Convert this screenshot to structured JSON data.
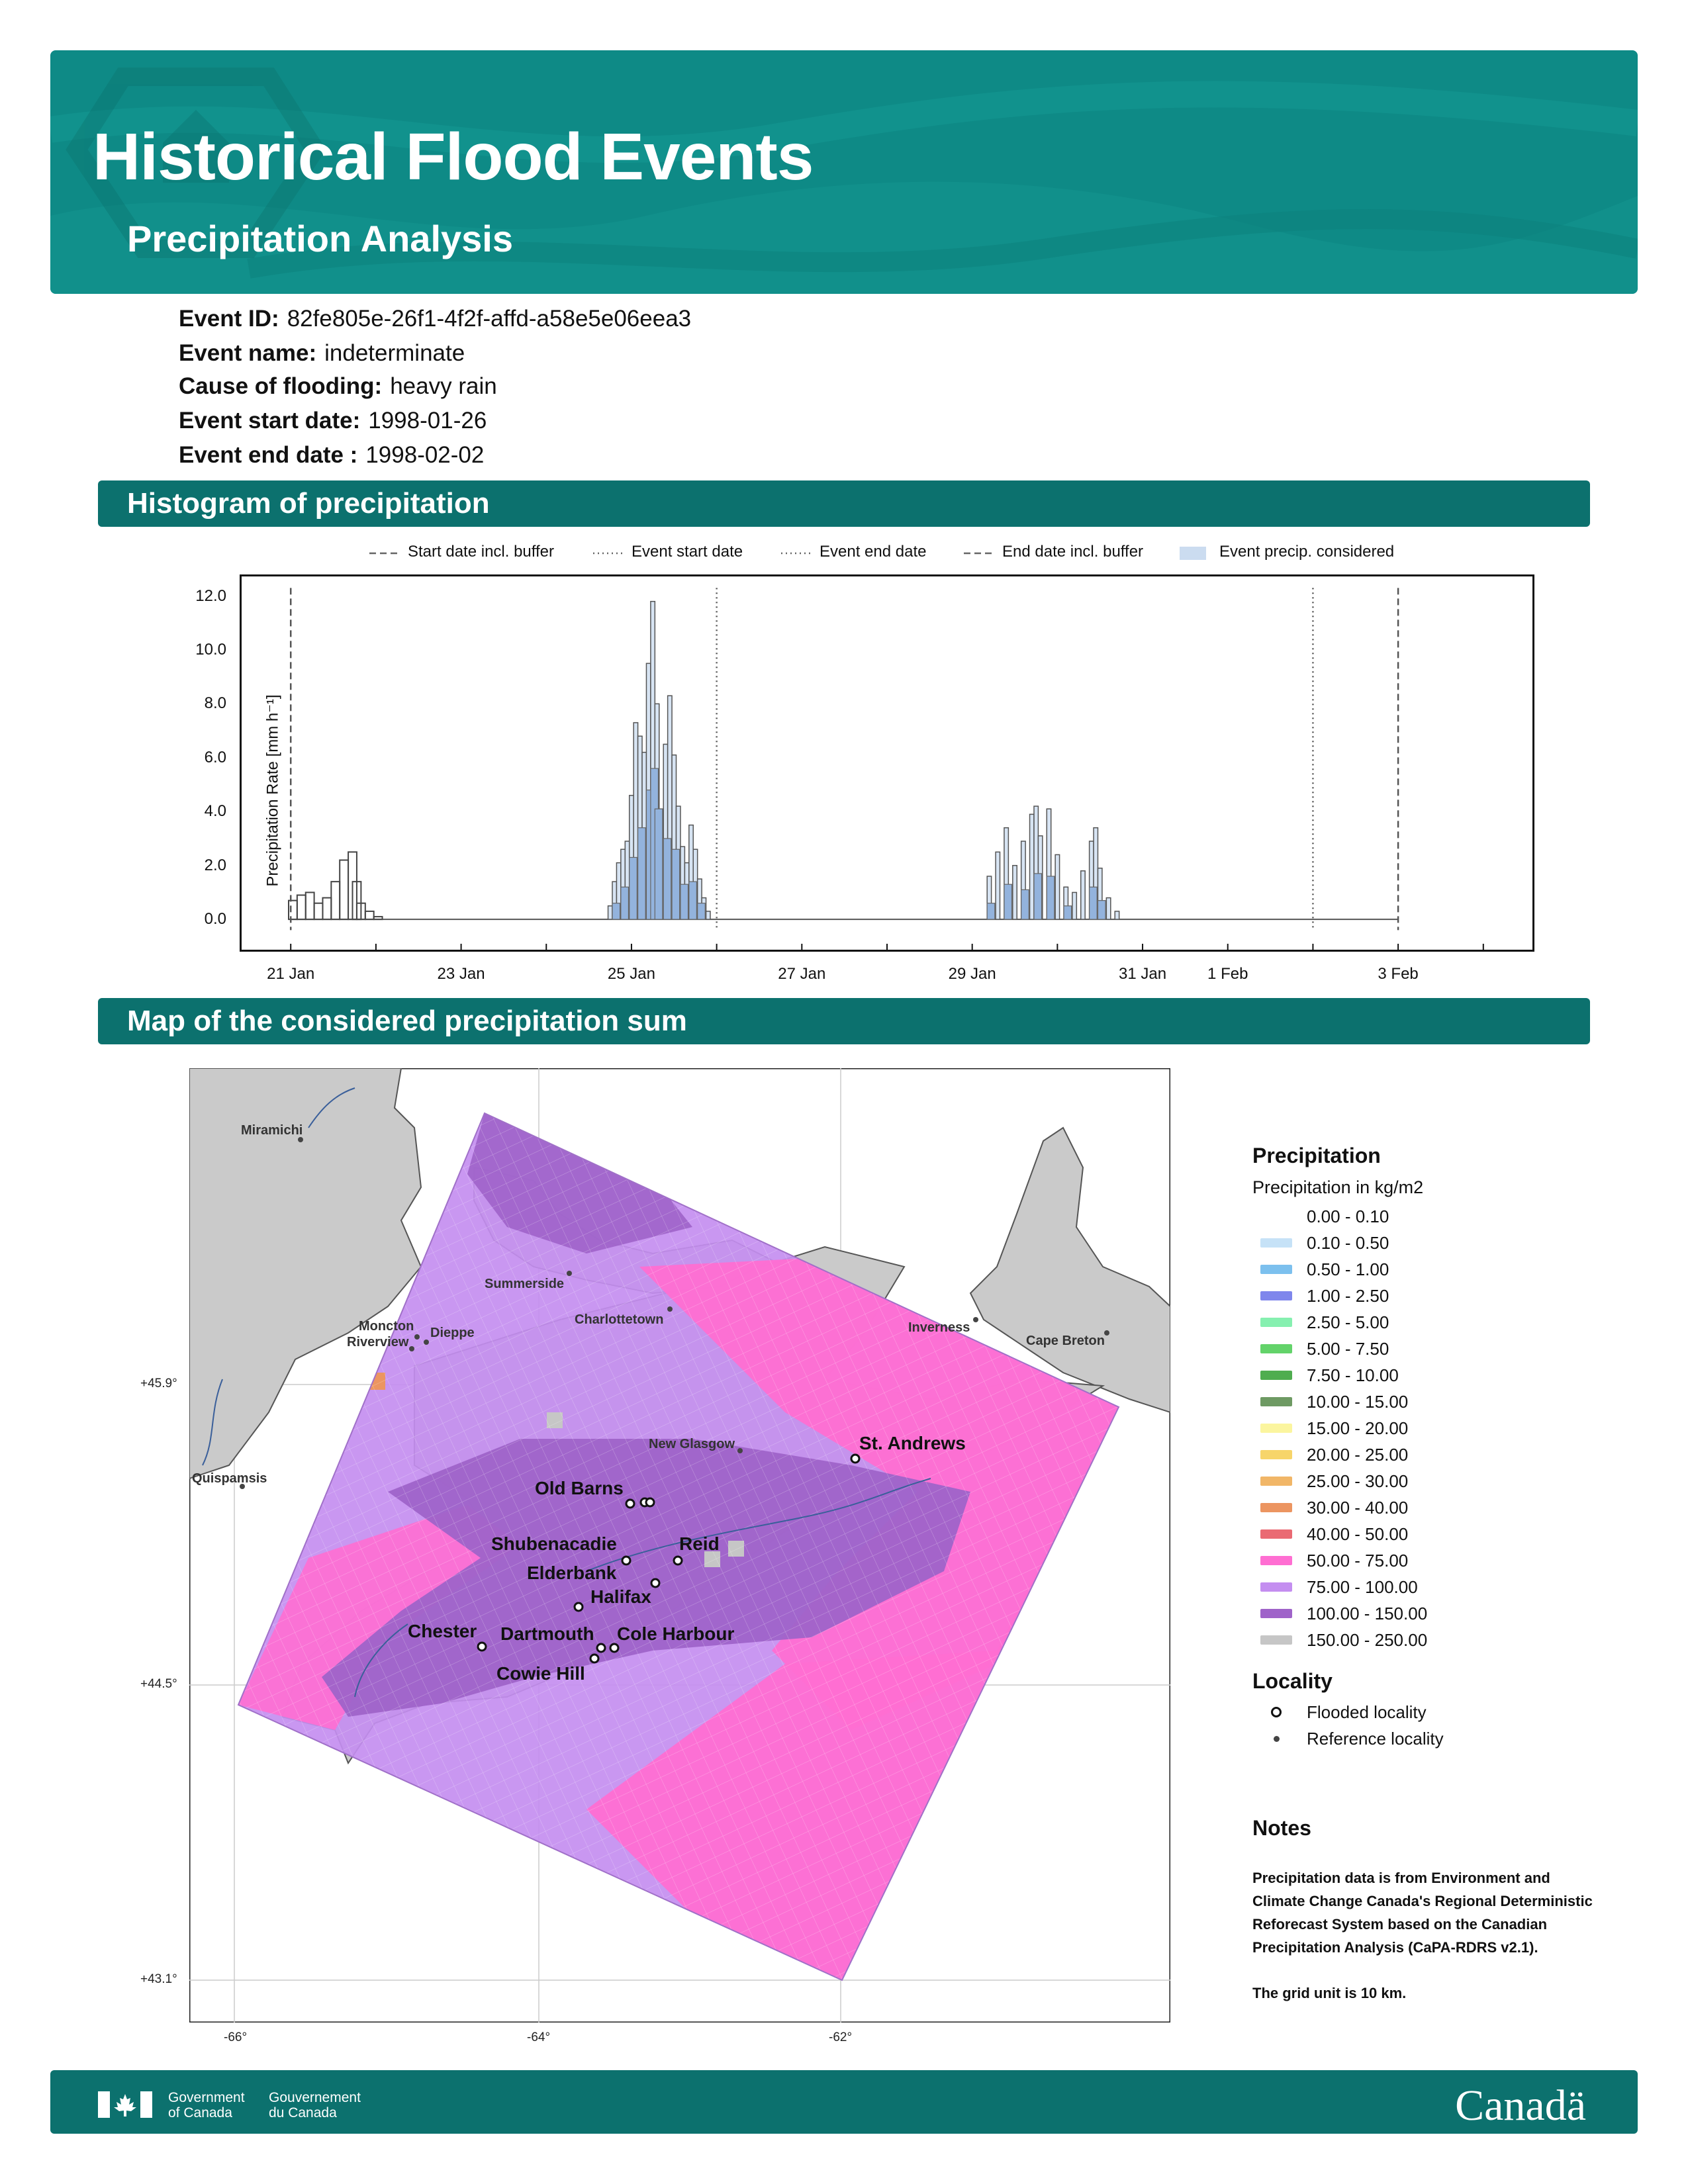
{
  "header": {
    "title": "Historical Flood Events",
    "subtitle": "Precipitation Analysis",
    "brand_color": "#0e8a86",
    "icon": "house-flood-logo"
  },
  "event": {
    "id_label": "Event ID:",
    "id_value": "82fe805e-26f1-4f2f-affd-a58e5e06eea3",
    "name_label": "Event name:",
    "name_value": "indeterminate",
    "cause_label": "Cause of flooding:",
    "cause_value": "heavy rain",
    "start_label": "Event start date:",
    "start_value": "1998-01-26",
    "end_label": "Event end date :",
    "end_value": "1998-02-02"
  },
  "sections": {
    "histogram_title": "Histogram of precipitation",
    "map_title": "Map of the considered precipitation sum"
  },
  "histogram_legend": {
    "start_buffer": "Start date incl. buffer",
    "event_start": "Event start date",
    "event_end": "Event end date",
    "end_buffer": "End date incl. buffer",
    "event_precip": "Event precip. considered"
  },
  "chart_data": {
    "type": "bar",
    "ylabel": "Precipitation Rate [mm h⁻¹]",
    "ylim": [
      -1.2,
      12.8
    ],
    "yticks": [
      "0.0",
      "2.0",
      "4.0",
      "6.0",
      "8.0",
      "10.0",
      "12.0"
    ],
    "xticks": [
      {
        "label": "21 Jan",
        "day": 21
      },
      {
        "label": "23 Jan",
        "day": 23
      },
      {
        "label": "25 Jan",
        "day": 25
      },
      {
        "label": "27 Jan",
        "day": 27
      },
      {
        "label": "29 Jan",
        "day": 29
      },
      {
        "label": "31 Jan",
        "day": 31
      },
      {
        "label": "1 Feb",
        "day": 32
      },
      {
        "label": "3 Feb",
        "day": 34
      }
    ],
    "xlim_days": [
      20.4,
      35.6
    ],
    "vlines": [
      {
        "day": 21.0,
        "style": "dashed"
      },
      {
        "day": 26.0,
        "style": "dotted"
      },
      {
        "day": 33.0,
        "style": "dotted"
      },
      {
        "day": 34.0,
        "style": "dashed"
      }
    ],
    "series": [
      {
        "kind": "event-max",
        "points": [
          [
            24.75,
            0.5
          ],
          [
            24.8,
            1.4
          ],
          [
            24.85,
            2.1
          ],
          [
            24.9,
            2.6
          ],
          [
            24.95,
            2.9
          ],
          [
            25.0,
            4.6
          ],
          [
            25.05,
            7.3
          ],
          [
            25.1,
            6.8
          ],
          [
            25.15,
            6.2
          ],
          [
            25.2,
            9.5
          ],
          [
            25.25,
            11.8
          ],
          [
            25.3,
            8.0
          ],
          [
            25.35,
            4.1
          ],
          [
            25.4,
            6.5
          ],
          [
            25.45,
            8.3
          ],
          [
            25.5,
            6.1
          ],
          [
            25.55,
            4.2
          ],
          [
            25.6,
            2.7
          ],
          [
            25.65,
            2.1
          ],
          [
            25.7,
            3.5
          ],
          [
            25.75,
            2.6
          ],
          [
            25.8,
            1.5
          ],
          [
            25.85,
            0.8
          ],
          [
            25.9,
            0.3
          ],
          [
            29.2,
            1.6
          ],
          [
            29.3,
            2.5
          ],
          [
            29.4,
            3.4
          ],
          [
            29.5,
            2.0
          ],
          [
            29.6,
            2.9
          ],
          [
            29.7,
            3.9
          ],
          [
            29.75,
            4.2
          ],
          [
            29.8,
            3.1
          ],
          [
            29.9,
            4.1
          ],
          [
            30.0,
            2.4
          ],
          [
            30.1,
            1.2
          ],
          [
            30.2,
            1.0
          ],
          [
            30.3,
            1.8
          ],
          [
            30.4,
            2.9
          ],
          [
            30.45,
            3.4
          ],
          [
            30.5,
            1.9
          ],
          [
            30.6,
            0.8
          ],
          [
            30.7,
            0.3
          ]
        ]
      },
      {
        "kind": "event-mean",
        "points": [
          [
            24.8,
            0.6
          ],
          [
            24.9,
            1.2
          ],
          [
            25.0,
            2.3
          ],
          [
            25.1,
            3.4
          ],
          [
            25.2,
            4.8
          ],
          [
            25.25,
            5.6
          ],
          [
            25.3,
            4.1
          ],
          [
            25.4,
            3.0
          ],
          [
            25.5,
            2.6
          ],
          [
            25.6,
            1.3
          ],
          [
            25.7,
            1.4
          ],
          [
            25.8,
            0.6
          ],
          [
            29.2,
            0.6
          ],
          [
            29.4,
            1.3
          ],
          [
            29.6,
            1.1
          ],
          [
            29.75,
            1.7
          ],
          [
            29.9,
            1.6
          ],
          [
            30.1,
            0.5
          ],
          [
            30.4,
            1.2
          ],
          [
            30.5,
            0.7
          ]
        ]
      },
      {
        "kind": "pre-event",
        "points": [
          [
            21.0,
            0.7
          ],
          [
            21.1,
            0.9
          ],
          [
            21.2,
            1.0
          ],
          [
            21.3,
            0.6
          ],
          [
            21.4,
            0.8
          ],
          [
            21.5,
            1.4
          ],
          [
            21.6,
            2.2
          ],
          [
            21.7,
            2.5
          ],
          [
            21.75,
            1.4
          ],
          [
            21.8,
            0.6
          ],
          [
            21.9,
            0.3
          ],
          [
            22.0,
            0.1
          ]
        ]
      }
    ]
  },
  "map": {
    "y_labels": [
      "+45.9°",
      "+44.5°",
      "+43.1°"
    ],
    "x_labels": [
      "-66°",
      "-64°",
      "-62°"
    ],
    "reference_localities": [
      "Miramichi",
      "Summerside",
      "Charlottetown",
      "Moncton",
      "Riverview",
      "Dieppe",
      "Inverness",
      "Cape Breton",
      "New Glasgow",
      "Quispamsis"
    ],
    "flooded_localities": [
      "St. Andrews",
      "Old Barns",
      "Shubenacadie",
      "Reid",
      "Elderbank",
      "Halifax",
      "Chester",
      "Dartmouth",
      "Cole Harbour",
      "Cowie Hill"
    ]
  },
  "legend": {
    "title": "Precipitation",
    "subtitle": "Precipitation in kg/m2",
    "classes": [
      {
        "label": "0.00 - 0.10",
        "color": "#ffffff"
      },
      {
        "label": "0.10 - 0.50",
        "color": "#c6e2f7"
      },
      {
        "label": "0.50 - 1.00",
        "color": "#7cc0ee"
      },
      {
        "label": "1.00 - 2.50",
        "color": "#7f86ec"
      },
      {
        "label": "2.50 - 5.00",
        "color": "#86f0b0"
      },
      {
        "label": "5.00 - 7.50",
        "color": "#63d36a"
      },
      {
        "label": "7.50 - 10.00",
        "color": "#4fad4f"
      },
      {
        "label": "10.00 - 15.00",
        "color": "#6e9a63"
      },
      {
        "label": "15.00 - 20.00",
        "color": "#fbf59f"
      },
      {
        "label": "20.00 - 25.00",
        "color": "#f7d56a"
      },
      {
        "label": "25.00 - 30.00",
        "color": "#f1b667"
      },
      {
        "label": "30.00 - 40.00",
        "color": "#ec9561"
      },
      {
        "label": "40.00 - 50.00",
        "color": "#ea6a73"
      },
      {
        "label": "50.00 - 75.00",
        "color": "#ff6ed2"
      },
      {
        "label": "75.00 - 100.00",
        "color": "#c48ef0"
      },
      {
        "label": "100.00 - 150.00",
        "color": "#9f63c9"
      },
      {
        "label": "150.00 - 250.00",
        "color": "#c6c6c6"
      }
    ],
    "locality_title": "Locality",
    "flooded": "Flooded locality",
    "reference": "Reference locality"
  },
  "notes": {
    "title": "Notes",
    "text1": "Precipitation data is from Environment and Climate Change Canada's Regional Deterministic Reforecast System based on the Canadian Precipitation Analysis (CaPA-RDRS v2.1).",
    "text2": "The grid unit is 10 km."
  },
  "footer": {
    "gov_en_1": "Government",
    "gov_en_2": "of Canada",
    "gov_fr_1": "Gouvernement",
    "gov_fr_2": "du Canada",
    "wordmark": "Canadä",
    "icon": "canada-flag-icon"
  }
}
